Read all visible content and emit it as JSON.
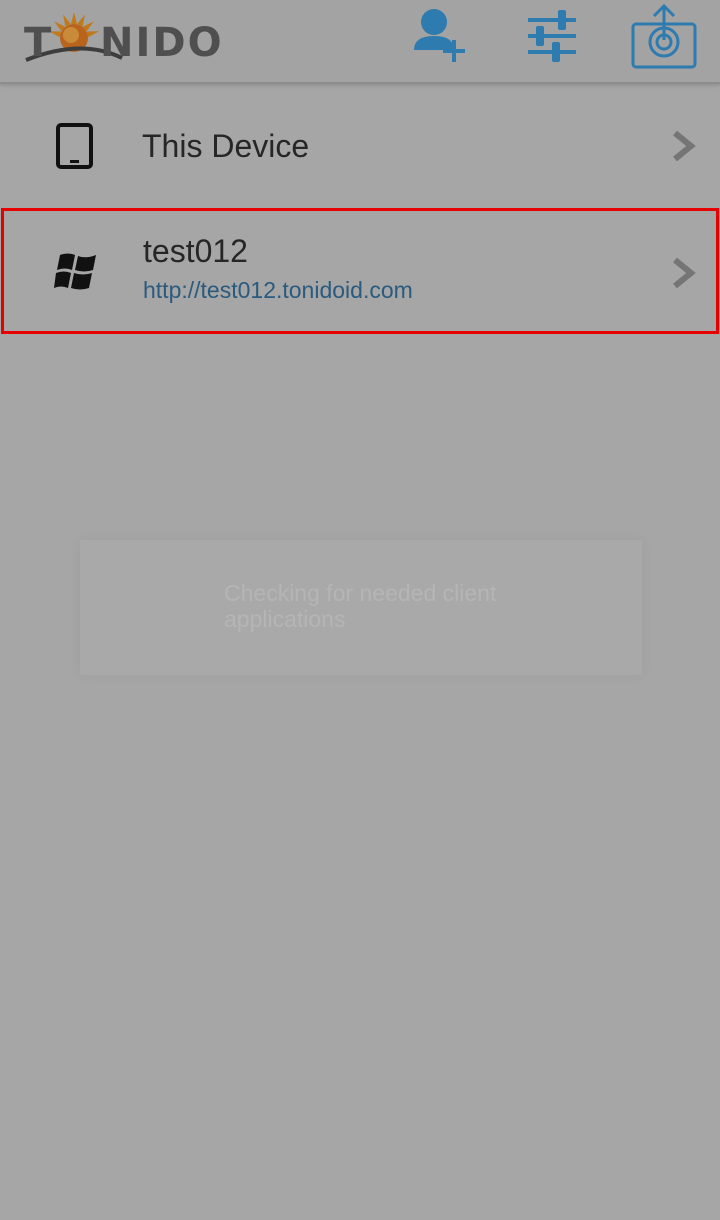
{
  "header": {
    "logo_rest": "NIDO",
    "logo_first": "T",
    "icons": [
      "add-user-icon",
      "settings-sliders-icon",
      "camera-upload-icon"
    ],
    "accent_color": "#2e7bb0"
  },
  "devices": [
    {
      "title": "This Device",
      "subtitle": "",
      "icon": "tablet-icon"
    },
    {
      "title": "test012",
      "subtitle": "http://test012.tonidoid.com",
      "icon": "windows-icon"
    }
  ],
  "dialog": {
    "message": "Checking for needed client applications"
  }
}
